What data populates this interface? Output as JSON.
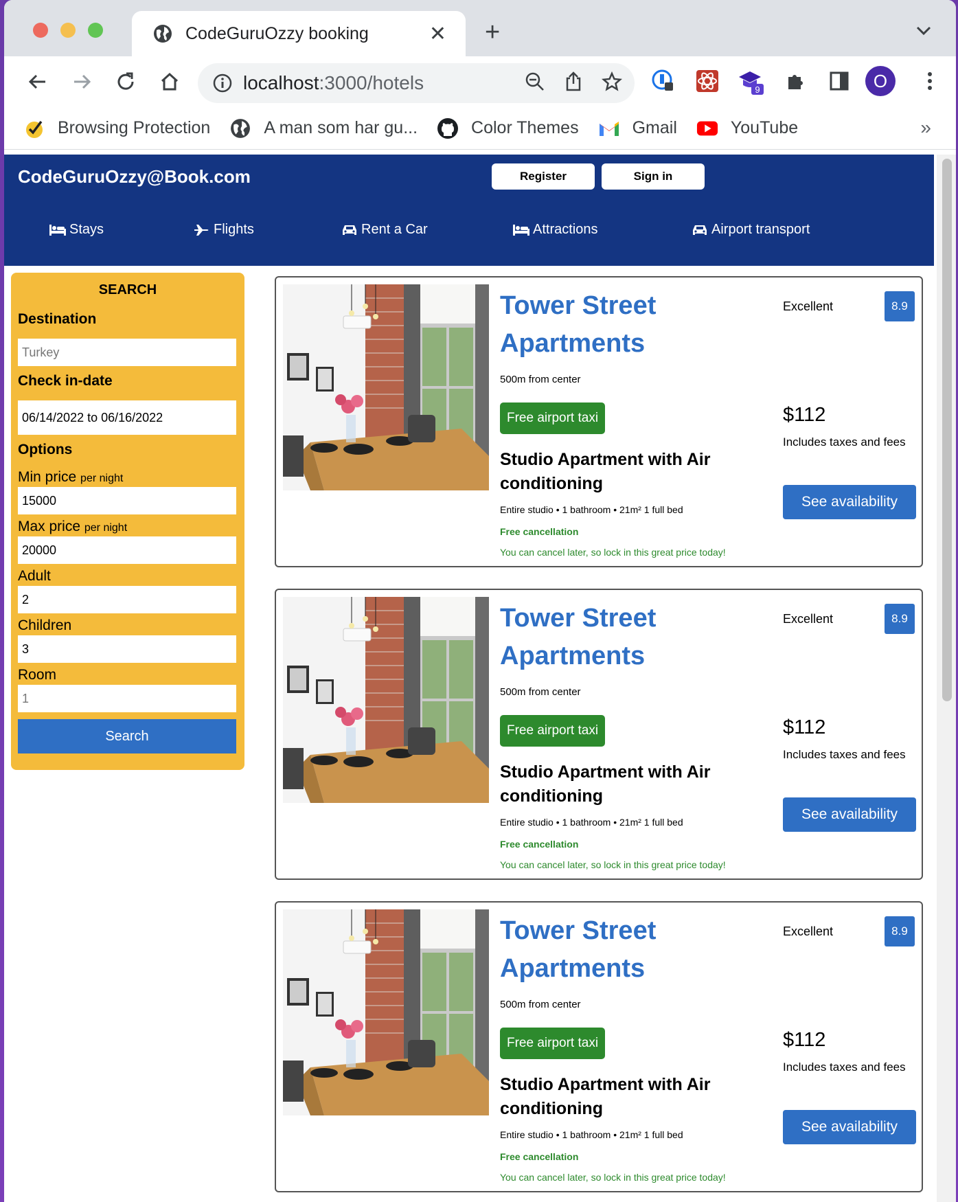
{
  "browser": {
    "tab_title": "CodeGuruOzzy booking",
    "url_host": "localhost",
    "url_path": ":3000/hotels",
    "extension_badge": "9",
    "profile_initial": "O",
    "bookmarks": [
      {
        "label": "Browsing Protection",
        "icon": "shield-check-icon"
      },
      {
        "label": "A man som har gu...",
        "icon": "globe-icon"
      },
      {
        "label": "Color Themes",
        "icon": "github-icon"
      },
      {
        "label": "Gmail",
        "icon": "gmail-icon"
      },
      {
        "label": "YouTube",
        "icon": "youtube-icon"
      }
    ],
    "bookmarks_more": "»"
  },
  "header": {
    "logo": "CodeGuruOzzy@Book.com",
    "register": "Register",
    "signin": "Sign in",
    "nav": [
      {
        "label": "Stays",
        "icon": "bed-icon"
      },
      {
        "label": "Flights",
        "icon": "plane-icon"
      },
      {
        "label": "Rent a Car",
        "icon": "car-icon"
      },
      {
        "label": "Attractions",
        "icon": "bed-icon"
      },
      {
        "label": "Airport transport",
        "icon": "taxi-icon"
      }
    ]
  },
  "search": {
    "title": "SEARCH",
    "destination_label": "Destination",
    "destination_placeholder": "Turkey",
    "checkin_label": "Check in-date",
    "checkin_value": "06/14/2022 to 06/16/2022",
    "options_label": "Options",
    "min_price_label": "Min price",
    "max_price_label": "Max price",
    "per_night": "per night",
    "min_price_value": "15000",
    "max_price_value": "20000",
    "adult_label": "Adult",
    "adult_value": "2",
    "children_label": "Children",
    "children_value": "3",
    "room_label": "Room",
    "room_placeholder": "1",
    "button": "Search"
  },
  "results": [
    {
      "name": "Tower Street Apartments",
      "distance": "500m from center",
      "taxi": "Free airport taxi",
      "room": "Studio Apartment with Air conditioning",
      "features": "Entire studio • 1 bathroom • 21m² 1 full bed",
      "cancel": "Free cancellation",
      "cancel_sub": "You can cancel later, so lock in this great price today!",
      "rating_text": "Excellent",
      "rating": "8.9",
      "price": "$112",
      "tax": "Includes taxes and fees",
      "button": "See availability"
    },
    {
      "name": "Tower Street Apartments",
      "distance": "500m from center",
      "taxi": "Free airport taxi",
      "room": "Studio Apartment with Air conditioning",
      "features": "Entire studio • 1 bathroom • 21m² 1 full bed",
      "cancel": "Free cancellation",
      "cancel_sub": "You can cancel later, so lock in this great price today!",
      "rating_text": "Excellent",
      "rating": "8.9",
      "price": "$112",
      "tax": "Includes taxes and fees",
      "button": "See availability"
    },
    {
      "name": "Tower Street Apartments",
      "distance": "500m from center",
      "taxi": "Free airport taxi",
      "room": "Studio Apartment with Air conditioning",
      "features": "Entire studio • 1 bathroom • 21m² 1 full bed",
      "cancel": "Free cancellation",
      "cancel_sub": "You can cancel later, so lock in this great price today!",
      "rating_text": "Excellent",
      "rating": "8.9",
      "price": "$112",
      "tax": "Includes taxes and fees",
      "button": "See availability"
    }
  ],
  "colors": {
    "header_bg": "#143582",
    "search_bg": "#f4bb3b",
    "accent_blue": "#2f6fc4",
    "green": "#2d8a2d"
  }
}
